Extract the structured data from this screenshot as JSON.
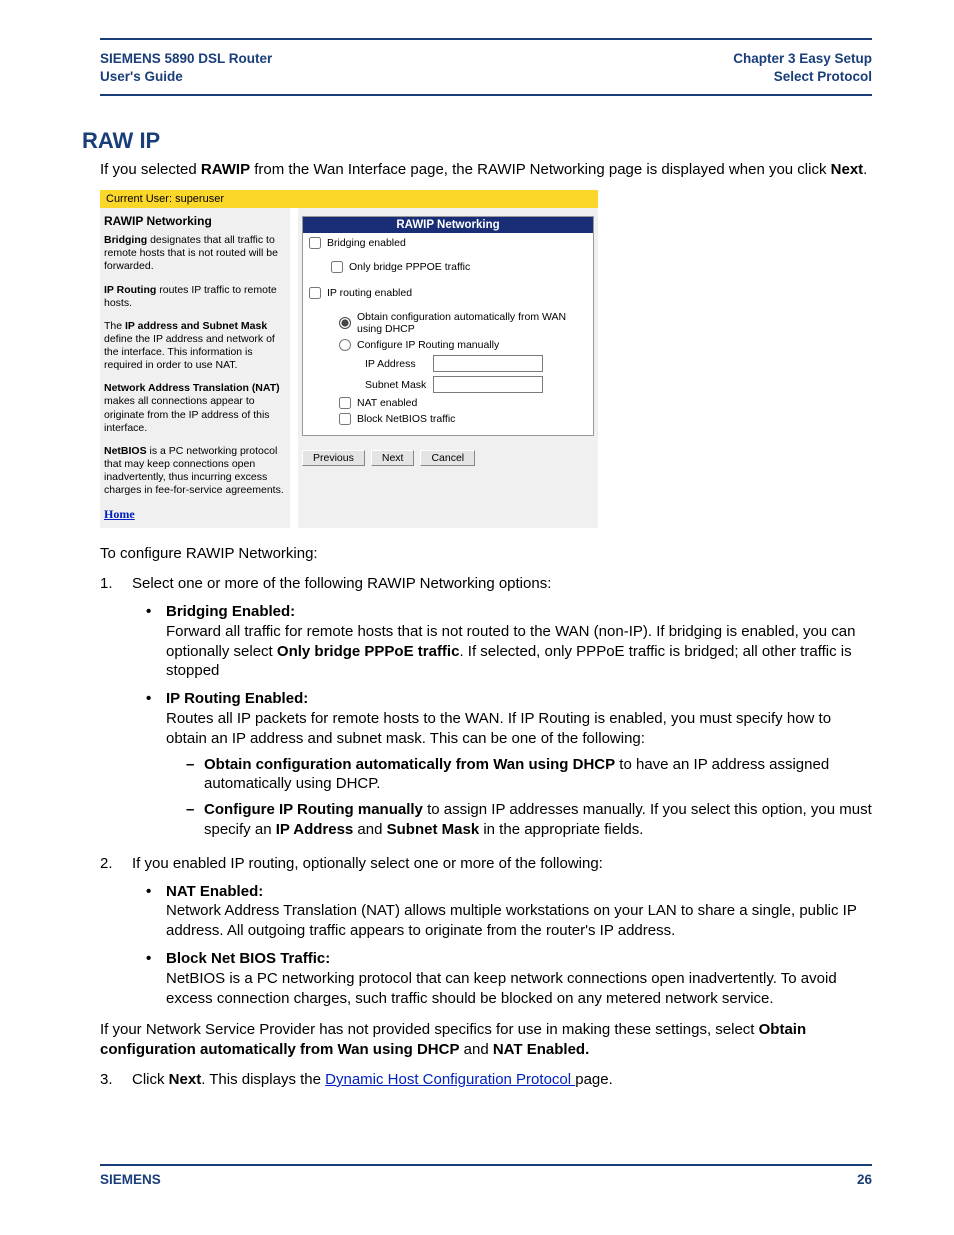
{
  "header": {
    "title_line1": "SIEMENS 5890 DSL Router",
    "title_line2": "User's Guide",
    "chapter": "Chapter 3  Easy Setup",
    "section": "Select Protocol"
  },
  "h1": "RAW IP",
  "intro_prefix": "If you selected ",
  "intro_bold1": "RAWIP",
  "intro_mid": " from the Wan Interface page, the RAWIP Networking page is displayed when you click ",
  "intro_bold2": "Next",
  "intro_suffix": ".",
  "embed": {
    "yellowbar": "Current User: superuser",
    "left": {
      "heading": "RAWIP Networking",
      "p1_b": "Bridging",
      "p1": " designates that all traffic to remote hosts that is not routed will be forwarded.",
      "p2_b": "IP Routing",
      "p2": " routes IP traffic to remote hosts.",
      "p3a": "The ",
      "p3_b": "IP address and Subnet Mask",
      "p3b": " define the IP address and network of the interface. This information is required in order to use NAT.",
      "p4_b": "Network Address Translation (NAT)",
      "p4": " makes all connections appear to originate from the IP address of this interface.",
      "p5_b": "NetBIOS",
      "p5": " is a PC networking protocol that may keep connections open inadvertently, thus incurring excess charges in fee-for-service agreements.",
      "home": "Home"
    },
    "panel": {
      "title": "RAWIP Networking",
      "bridging": "Bridging enabled",
      "only_pppoe": "Only bridge PPPOE traffic",
      "iprouting": "IP routing enabled",
      "radio_dhcp": "Obtain configuration automatically from WAN using DHCP",
      "radio_manual": "Configure IP Routing manually",
      "ipaddr_label": "IP Address",
      "subnet_label": "Subnet Mask",
      "nat": "NAT enabled",
      "netbios": "Block NetBIOS traffic"
    },
    "buttons": {
      "prev": "Previous",
      "next": "Next",
      "cancel": "Cancel"
    }
  },
  "configure_line": "To configure RAWIP Networking:",
  "step1": "Select one or more of the following RAWIP Networking options:",
  "bridging_b": "Bridging Enabled:",
  "bridging_desc_a": "Forward all traffic for remote hosts that is not routed to the WAN (non-IP). If bridging is enabled, you can optionally select ",
  "bridging_desc_bold": "Only bridge PPPoE traffic",
  "bridging_desc_b": ". If selected, only PPPoE traffic is bridged; all other traffic is stopped",
  "iprouting_b": "IP Routing Enabled:",
  "iprouting_desc": "Routes all IP packets for remote hosts to the WAN. If IP Routing is enabled, you must specify how to obtain an IP address and subnet mask. This can be one of the following:",
  "dash1_b": "Obtain configuration automatically from Wan using DHCP",
  "dash1_t": " to have an IP address assigned automatically using DHCP.",
  "dash2_b": "Configure IP Routing manually",
  "dash2_t1": " to assign IP addresses manually. If you select this option, you must specify an ",
  "dash2_b2": "IP Address",
  "dash2_t2": " and ",
  "dash2_b3": "Subnet Mask",
  "dash2_t3": " in the appropriate fields.",
  "step2": "If you enabled IP routing, optionally select one or more of the following:",
  "nat_b": "NAT Enabled:",
  "nat_desc": "Network Address Translation (NAT) allows multiple workstations on your LAN to share a single, public IP address. All outgoing traffic appears to originate from the router's IP address.",
  "netbios_b": "Block Net BIOS Traffic:",
  "netbios_desc": "NetBIOS is a PC networking protocol that can keep network connections open inadvertently. To avoid excess connection charges, such traffic should be blocked on any metered network service.",
  "nsp_a": "If your Network Service Provider has not provided specifics for use in making these settings, select ",
  "nsp_b1": "Obtain configuration automatically from Wan using DHCP",
  "nsp_mid": " and ",
  "nsp_b2": "NAT Enabled.",
  "step3_a": "Click ",
  "step3_b": "Next",
  "step3_c": ". This displays the ",
  "step3_link": "Dynamic Host Configuration Protocol ",
  "step3_d": "page.",
  "footer": {
    "brand": "SIEMENS",
    "page": "26"
  }
}
